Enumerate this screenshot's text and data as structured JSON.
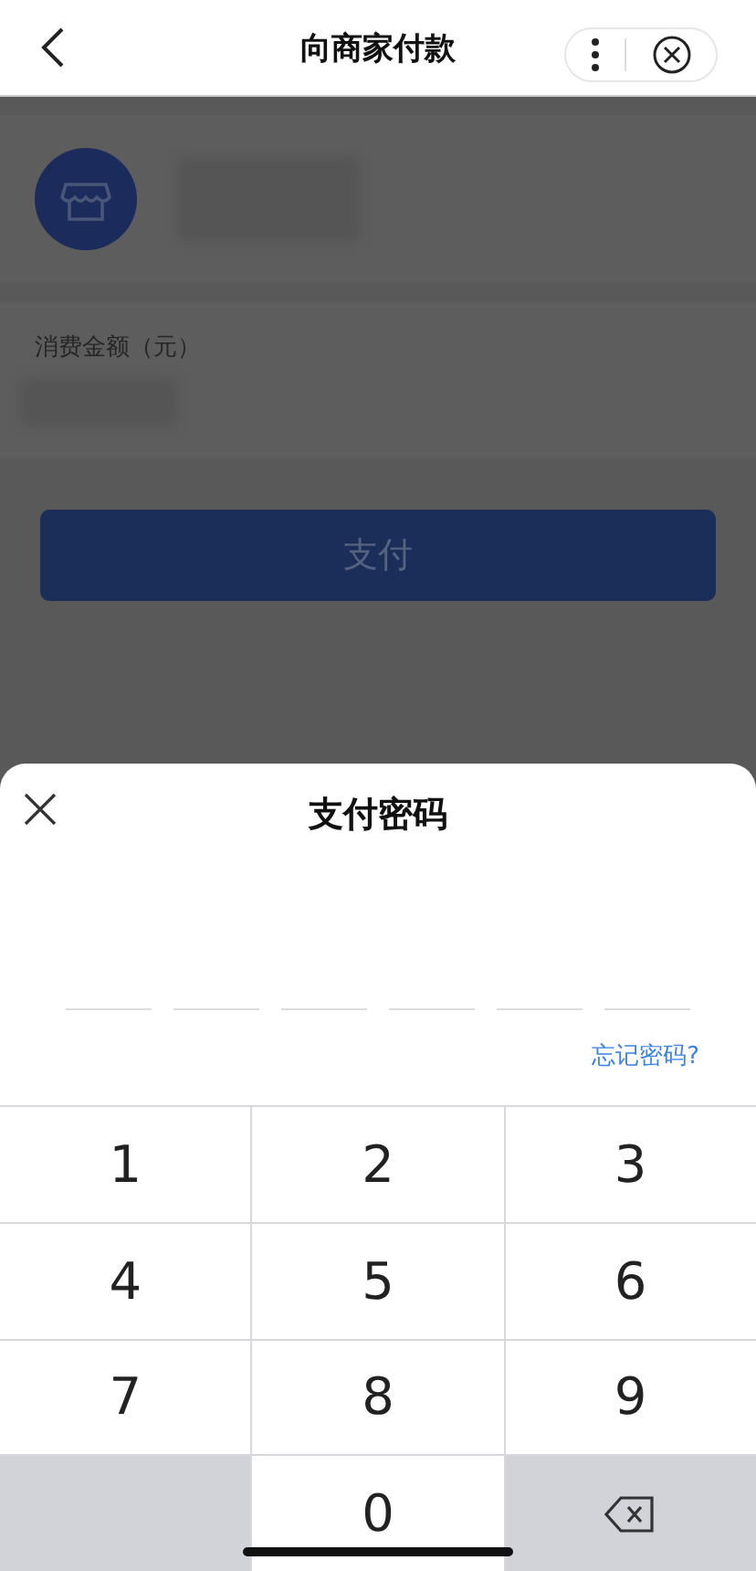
{
  "header": {
    "title": "向商家付款"
  },
  "amount": {
    "label": "消费金额（元）"
  },
  "pay_button": {
    "label": "支付"
  },
  "password_sheet": {
    "title": "支付密码",
    "slots": [
      {
        "filled": false
      },
      {
        "filled": false
      },
      {
        "filled": false
      },
      {
        "filled": false
      },
      {
        "filled": false
      },
      {
        "filled": false
      }
    ],
    "forgot_link": "忘记密码?"
  },
  "keypad": [
    {
      "kind": "digit",
      "label": "1"
    },
    {
      "kind": "digit",
      "label": "2"
    },
    {
      "kind": "digit",
      "label": "3"
    },
    {
      "kind": "digit",
      "label": "4"
    },
    {
      "kind": "digit",
      "label": "5"
    },
    {
      "kind": "digit",
      "label": "6"
    },
    {
      "kind": "digit",
      "label": "7"
    },
    {
      "kind": "digit",
      "label": "8"
    },
    {
      "kind": "digit",
      "label": "9"
    },
    {
      "kind": "blank"
    },
    {
      "kind": "digit",
      "label": "0"
    },
    {
      "kind": "delete"
    }
  ]
}
